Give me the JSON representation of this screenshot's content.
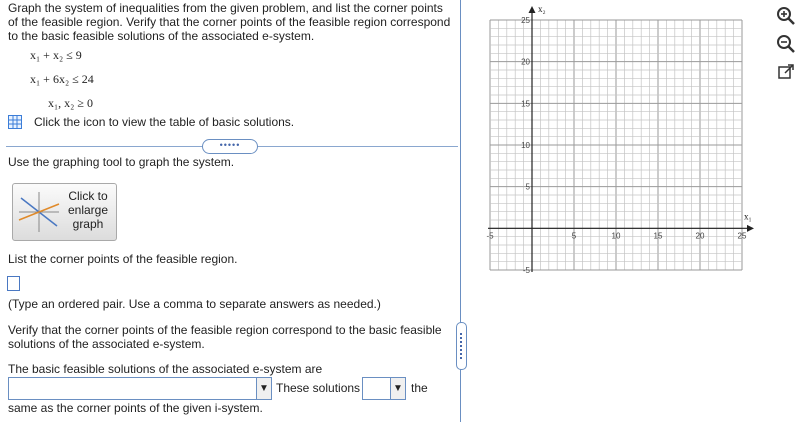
{
  "question": {
    "instructions": "Graph the system of inequalities from the given problem, and list the corner points of the feasible region. Verify that the corner points of the feasible region correspond to the basic feasible solutions of the associated e-system.",
    "inequalities": [
      {
        "lhs": "x₁ +  x₂",
        "op": "≤",
        "rhs": "9"
      },
      {
        "lhs": "x₁ + 6x₂",
        "op": "≤",
        "rhs": "24"
      },
      {
        "lhs": "x₁, x₂",
        "op": "≥",
        "rhs": "0"
      }
    ],
    "table_link": "Click the icon to view the table of basic solutions.",
    "expand_dots": "•••••",
    "graph_instruction": "Use the graphing tool to graph the system.",
    "enlarge_button": "Click to enlarge graph",
    "corner_points_prompt": "List the corner points of the feasible region.",
    "answer_hint": "(Type an ordered pair. Use a comma to separate answers as needed.)",
    "verify_prompt": "Verify that the corner points of the feasible region correspond to the basic feasible solutions of the associated e-system.",
    "bfs_prompt": "The basic feasible solutions of the associated e-system are",
    "these_solutions": "These solutions",
    "the": "the",
    "same_as": "same as the corner points of the given i-system."
  },
  "graph": {
    "x_axis_label": "x₁",
    "y_axis_label": "x₂",
    "x_ticks": [
      "-5",
      "5",
      "10",
      "15",
      "20",
      "25"
    ],
    "y_ticks": [
      "25",
      "20",
      "15",
      "10",
      "5",
      "-5"
    ]
  },
  "toolbar": {
    "zoom_in_icon": "magnifier-plus",
    "zoom_out_icon": "magnifier-minus",
    "popout_icon": "external-link"
  },
  "colors": {
    "accent": "#6a8fc2",
    "input_border": "#4a78c2",
    "grid": "#b0b0b0"
  }
}
